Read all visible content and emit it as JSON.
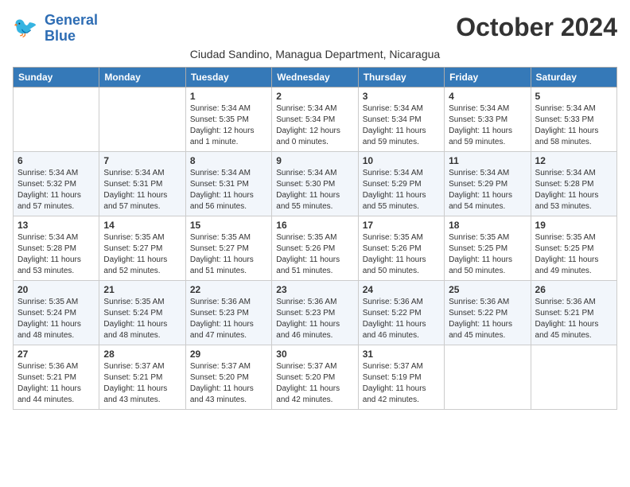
{
  "logo": {
    "line1": "General",
    "line2": "Blue"
  },
  "title": "October 2024",
  "subtitle": "Ciudad Sandino, Managua Department, Nicaragua",
  "days_of_week": [
    "Sunday",
    "Monday",
    "Tuesday",
    "Wednesday",
    "Thursday",
    "Friday",
    "Saturday"
  ],
  "weeks": [
    [
      {
        "day": "",
        "sunrise": "",
        "sunset": "",
        "daylight": ""
      },
      {
        "day": "",
        "sunrise": "",
        "sunset": "",
        "daylight": ""
      },
      {
        "day": "1",
        "sunrise": "Sunrise: 5:34 AM",
        "sunset": "Sunset: 5:35 PM",
        "daylight": "Daylight: 12 hours and 1 minute."
      },
      {
        "day": "2",
        "sunrise": "Sunrise: 5:34 AM",
        "sunset": "Sunset: 5:34 PM",
        "daylight": "Daylight: 12 hours and 0 minutes."
      },
      {
        "day": "3",
        "sunrise": "Sunrise: 5:34 AM",
        "sunset": "Sunset: 5:34 PM",
        "daylight": "Daylight: 11 hours and 59 minutes."
      },
      {
        "day": "4",
        "sunrise": "Sunrise: 5:34 AM",
        "sunset": "Sunset: 5:33 PM",
        "daylight": "Daylight: 11 hours and 59 minutes."
      },
      {
        "day": "5",
        "sunrise": "Sunrise: 5:34 AM",
        "sunset": "Sunset: 5:33 PM",
        "daylight": "Daylight: 11 hours and 58 minutes."
      }
    ],
    [
      {
        "day": "6",
        "sunrise": "Sunrise: 5:34 AM",
        "sunset": "Sunset: 5:32 PM",
        "daylight": "Daylight: 11 hours and 57 minutes."
      },
      {
        "day": "7",
        "sunrise": "Sunrise: 5:34 AM",
        "sunset": "Sunset: 5:31 PM",
        "daylight": "Daylight: 11 hours and 57 minutes."
      },
      {
        "day": "8",
        "sunrise": "Sunrise: 5:34 AM",
        "sunset": "Sunset: 5:31 PM",
        "daylight": "Daylight: 11 hours and 56 minutes."
      },
      {
        "day": "9",
        "sunrise": "Sunrise: 5:34 AM",
        "sunset": "Sunset: 5:30 PM",
        "daylight": "Daylight: 11 hours and 55 minutes."
      },
      {
        "day": "10",
        "sunrise": "Sunrise: 5:34 AM",
        "sunset": "Sunset: 5:29 PM",
        "daylight": "Daylight: 11 hours and 55 minutes."
      },
      {
        "day": "11",
        "sunrise": "Sunrise: 5:34 AM",
        "sunset": "Sunset: 5:29 PM",
        "daylight": "Daylight: 11 hours and 54 minutes."
      },
      {
        "day": "12",
        "sunrise": "Sunrise: 5:34 AM",
        "sunset": "Sunset: 5:28 PM",
        "daylight": "Daylight: 11 hours and 53 minutes."
      }
    ],
    [
      {
        "day": "13",
        "sunrise": "Sunrise: 5:34 AM",
        "sunset": "Sunset: 5:28 PM",
        "daylight": "Daylight: 11 hours and 53 minutes."
      },
      {
        "day": "14",
        "sunrise": "Sunrise: 5:35 AM",
        "sunset": "Sunset: 5:27 PM",
        "daylight": "Daylight: 11 hours and 52 minutes."
      },
      {
        "day": "15",
        "sunrise": "Sunrise: 5:35 AM",
        "sunset": "Sunset: 5:27 PM",
        "daylight": "Daylight: 11 hours and 51 minutes."
      },
      {
        "day": "16",
        "sunrise": "Sunrise: 5:35 AM",
        "sunset": "Sunset: 5:26 PM",
        "daylight": "Daylight: 11 hours and 51 minutes."
      },
      {
        "day": "17",
        "sunrise": "Sunrise: 5:35 AM",
        "sunset": "Sunset: 5:26 PM",
        "daylight": "Daylight: 11 hours and 50 minutes."
      },
      {
        "day": "18",
        "sunrise": "Sunrise: 5:35 AM",
        "sunset": "Sunset: 5:25 PM",
        "daylight": "Daylight: 11 hours and 50 minutes."
      },
      {
        "day": "19",
        "sunrise": "Sunrise: 5:35 AM",
        "sunset": "Sunset: 5:25 PM",
        "daylight": "Daylight: 11 hours and 49 minutes."
      }
    ],
    [
      {
        "day": "20",
        "sunrise": "Sunrise: 5:35 AM",
        "sunset": "Sunset: 5:24 PM",
        "daylight": "Daylight: 11 hours and 48 minutes."
      },
      {
        "day": "21",
        "sunrise": "Sunrise: 5:35 AM",
        "sunset": "Sunset: 5:24 PM",
        "daylight": "Daylight: 11 hours and 48 minutes."
      },
      {
        "day": "22",
        "sunrise": "Sunrise: 5:36 AM",
        "sunset": "Sunset: 5:23 PM",
        "daylight": "Daylight: 11 hours and 47 minutes."
      },
      {
        "day": "23",
        "sunrise": "Sunrise: 5:36 AM",
        "sunset": "Sunset: 5:23 PM",
        "daylight": "Daylight: 11 hours and 46 minutes."
      },
      {
        "day": "24",
        "sunrise": "Sunrise: 5:36 AM",
        "sunset": "Sunset: 5:22 PM",
        "daylight": "Daylight: 11 hours and 46 minutes."
      },
      {
        "day": "25",
        "sunrise": "Sunrise: 5:36 AM",
        "sunset": "Sunset: 5:22 PM",
        "daylight": "Daylight: 11 hours and 45 minutes."
      },
      {
        "day": "26",
        "sunrise": "Sunrise: 5:36 AM",
        "sunset": "Sunset: 5:21 PM",
        "daylight": "Daylight: 11 hours and 45 minutes."
      }
    ],
    [
      {
        "day": "27",
        "sunrise": "Sunrise: 5:36 AM",
        "sunset": "Sunset: 5:21 PM",
        "daylight": "Daylight: 11 hours and 44 minutes."
      },
      {
        "day": "28",
        "sunrise": "Sunrise: 5:37 AM",
        "sunset": "Sunset: 5:21 PM",
        "daylight": "Daylight: 11 hours and 43 minutes."
      },
      {
        "day": "29",
        "sunrise": "Sunrise: 5:37 AM",
        "sunset": "Sunset: 5:20 PM",
        "daylight": "Daylight: 11 hours and 43 minutes."
      },
      {
        "day": "30",
        "sunrise": "Sunrise: 5:37 AM",
        "sunset": "Sunset: 5:20 PM",
        "daylight": "Daylight: 11 hours and 42 minutes."
      },
      {
        "day": "31",
        "sunrise": "Sunrise: 5:37 AM",
        "sunset": "Sunset: 5:19 PM",
        "daylight": "Daylight: 11 hours and 42 minutes."
      },
      {
        "day": "",
        "sunrise": "",
        "sunset": "",
        "daylight": ""
      },
      {
        "day": "",
        "sunrise": "",
        "sunset": "",
        "daylight": ""
      }
    ]
  ]
}
